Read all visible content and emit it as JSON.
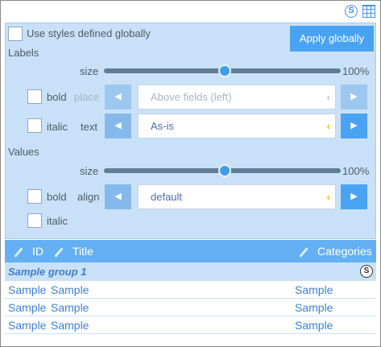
{
  "toolbar": {
    "styles_icon": "circle-s-icon",
    "grid_icon": "grid-icon"
  },
  "global": {
    "use_label": "Use styles defined globally",
    "apply_label": "Apply globally"
  },
  "labels": {
    "heading": "Labels",
    "size_label": "size",
    "size_value": "100%",
    "size_fraction": 0.51,
    "bold_label": "bold",
    "italic_label": "italic",
    "place_label": "place",
    "place_value": "Above fields (left)",
    "text_label": "text",
    "text_value": "As-is"
  },
  "values": {
    "heading": "Values",
    "size_label": "size",
    "size_value": "100%",
    "size_fraction": 0.51,
    "bold_label": "bold",
    "italic_label": "italic",
    "align_label": "align",
    "align_value": "default"
  },
  "table": {
    "columns": [
      "ID",
      "Title",
      "Categories"
    ],
    "group": "Sample group 1",
    "rows": [
      [
        "Sample",
        "Sample",
        "Sample"
      ],
      [
        "Sample",
        "Sample",
        "Sample"
      ],
      [
        "Sample",
        "Sample",
        "Sample"
      ]
    ]
  },
  "colors": {
    "accent": "#4aa3f2",
    "panel": "#c9e1f8",
    "header": "#63b0f2",
    "caret": "#e8c200"
  }
}
